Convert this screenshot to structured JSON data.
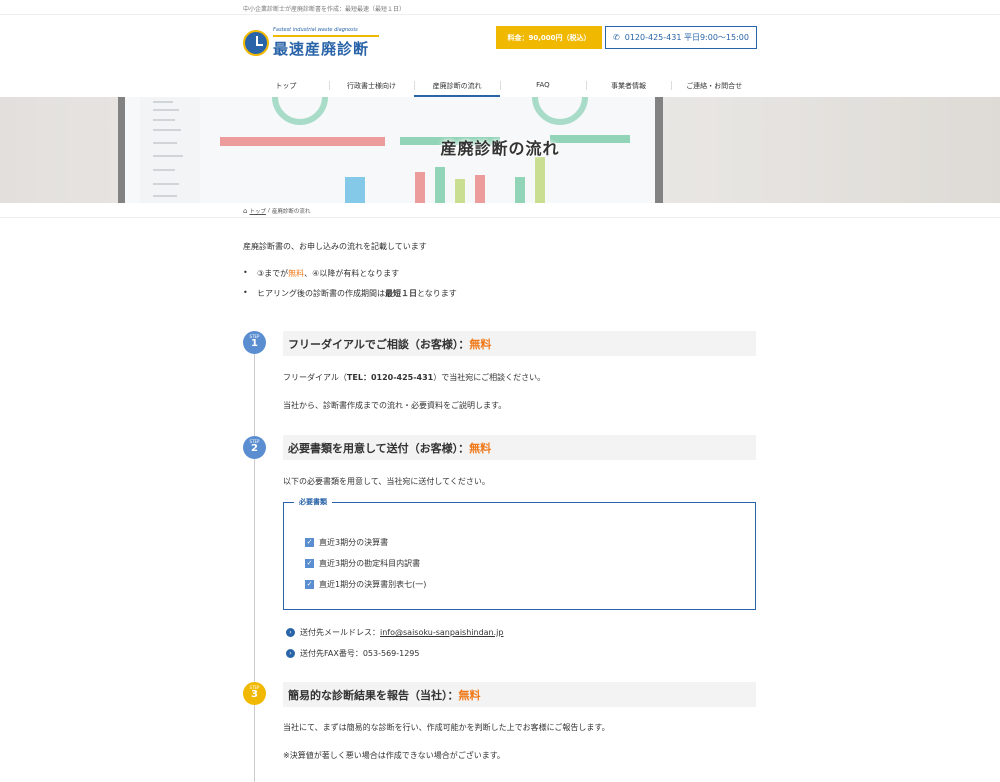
{
  "topbar": {
    "text": "中小企業診断士が産廃診断書を作成：最短最速（最短１日）"
  },
  "header": {
    "logo_sub": "Fastest industrial waste diagnosis",
    "logo_title": "最速産廃診断",
    "price_button": "料金：90,000円（税込）",
    "phone_button": "0120-425-431 平日9:00〜15:00"
  },
  "nav": {
    "items": [
      {
        "label": "トップ"
      },
      {
        "label": "行政書士様向け"
      },
      {
        "label": "産廃診断の流れ"
      },
      {
        "label": "FAQ"
      },
      {
        "label": "事業者情報"
      },
      {
        "label": "ご連絡・お問合せ"
      }
    ]
  },
  "hero": {
    "title": "産廃診断の流れ"
  },
  "breadcrumb": {
    "home": "トップ",
    "separator": "/",
    "current": "産廃診断の流れ"
  },
  "intro": "産廃診断書の、お申し込みの流れを記載しています",
  "bullets": [
    {
      "pre": "③までが",
      "hl": "無料",
      "post": "、④以降が有料となります"
    },
    {
      "pre": "ヒアリング後の診断書の作成期間は",
      "hl": "最短１日",
      "post": "となります"
    }
  ],
  "steps": [
    {
      "word": "STEP",
      "num": "1",
      "title": "フリーダイアルでご相談（お客様）：",
      "free": "無料",
      "text1_pre": "フリーダイアル（",
      "text1_bold": "TEL：0120-425-431",
      "text1_post": "）で当社宛にご相談ください。",
      "text2": "当社から、診断書作成までの流れ・必要資料をご説明します。"
    },
    {
      "word": "STEP",
      "num": "2",
      "title": "必要書類を用意して送付（お客様）：",
      "free": "無料",
      "text1": "以下の必要書類を用意して、当社宛に送付してください。",
      "docs_label": "必要書類",
      "docs": [
        "直近3期分の決算書",
        "直近3期分の勘定科目内訳書",
        "直近1期分の決算書別表七(一)"
      ],
      "mail_label": "送付先メールドレス：",
      "mail": "info@saisoku-sanpaishindan.jp",
      "fax": "送付先FAX番号：053-569-1295"
    },
    {
      "word": "STEP",
      "num": "3",
      "title": "簡易的な診断結果を報告（当社）：",
      "free": "無料",
      "text1": "当社にて、まずは簡易的な診断を行い、作成可能かを判断した上でお客様にご報告します。",
      "text2": "※決算値が著しく悪い場合は作成できない場合がございます。"
    }
  ],
  "colors": {
    "brand": "#2a64a8",
    "accent": "#f1b800",
    "free": "#f07a1b"
  },
  "icons": {
    "phone": "phone-icon",
    "home": "home-icon",
    "check": "check-icon",
    "arrow": "arrow-right-circle-icon"
  }
}
